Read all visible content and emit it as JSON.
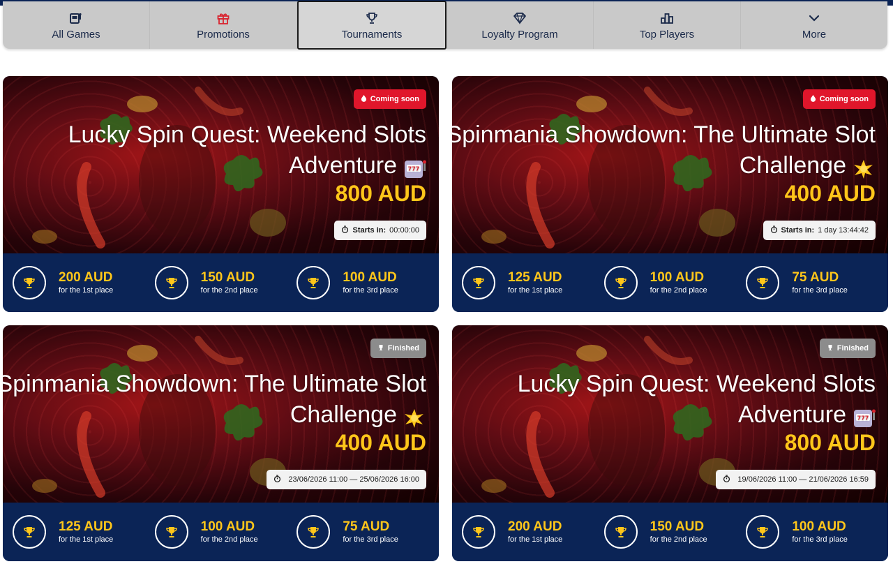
{
  "nav": [
    {
      "label": "All Games",
      "icon": "slot-machine-icon"
    },
    {
      "label": "Promotions",
      "icon": "gift-icon"
    },
    {
      "label": "Tournaments",
      "icon": "trophy-icon"
    },
    {
      "label": "Loyalty Program",
      "icon": "diamond-icon"
    },
    {
      "label": "Top Players",
      "icon": "podium-icon"
    },
    {
      "label": "More",
      "icon": "chevron-down-icon"
    }
  ],
  "active_tab": "Tournaments",
  "colors": {
    "accent": "#ffc61a",
    "navy": "#0b2456",
    "soon": "#e0162b",
    "finished": "#8c8c8c"
  },
  "cards": [
    {
      "status": "Coming soon",
      "title_line1": "Lucky Spin Quest: Weekend Slots",
      "title_line2": "Adventure",
      "emoji": "slot-machine-emoji",
      "prize": "800 AUD",
      "timer_label": "Starts in:",
      "timer_value": "00:00:00",
      "places": [
        {
          "amount": "200 AUD",
          "label": "for the 1st place"
        },
        {
          "amount": "150 AUD",
          "label": "for the 2nd place"
        },
        {
          "amount": "100 AUD",
          "label": "for the 3rd place"
        }
      ]
    },
    {
      "status": "Coming soon",
      "title_line1": "Spinmania Showdown: The Ultimate Slot",
      "title_line2": "Challenge",
      "emoji": "sparkle-emoji",
      "prize": "400 AUD",
      "timer_label": "Starts in:",
      "timer_value": "1 day 13:44:42",
      "places": [
        {
          "amount": "125 AUD",
          "label": "for the 1st place"
        },
        {
          "amount": "100 AUD",
          "label": "for the 2nd place"
        },
        {
          "amount": "75 AUD",
          "label": "for the 3rd place"
        }
      ]
    },
    {
      "status": "Finished",
      "title_line1": "Spinmania Showdown: The Ultimate Slot",
      "title_line2": "Challenge",
      "emoji": "sparkle-emoji",
      "prize": "400 AUD",
      "timer_label": "",
      "timer_value": "23/06/2026 11:00 — 25/06/2026 16:00",
      "places": [
        {
          "amount": "125 AUD",
          "label": "for the 1st place"
        },
        {
          "amount": "100 AUD",
          "label": "for the 2nd place"
        },
        {
          "amount": "75 AUD",
          "label": "for the 3rd place"
        }
      ]
    },
    {
      "status": "Finished",
      "title_line1": "Lucky Spin Quest: Weekend Slots",
      "title_line2": "Adventure",
      "emoji": "slot-machine-emoji",
      "prize": "800 AUD",
      "timer_label": "",
      "timer_value": "19/06/2026 11:00 — 21/06/2026 16:59",
      "places": [
        {
          "amount": "200 AUD",
          "label": "for the 1st place"
        },
        {
          "amount": "150 AUD",
          "label": "for the 2nd place"
        },
        {
          "amount": "100 AUD",
          "label": "for the 3rd place"
        }
      ]
    }
  ]
}
